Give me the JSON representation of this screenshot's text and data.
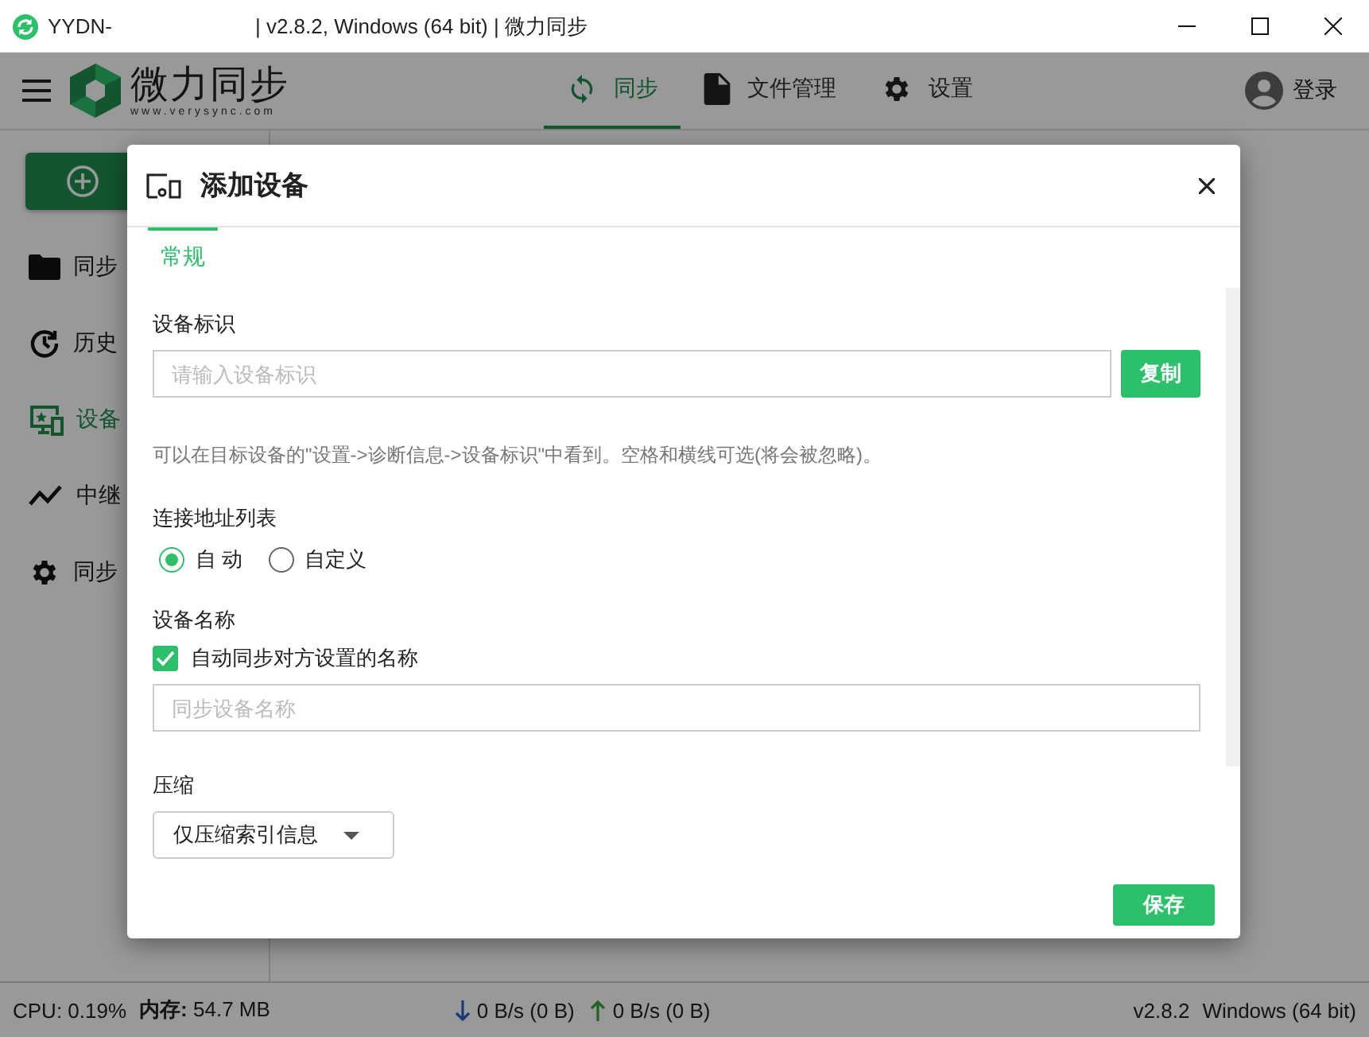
{
  "window": {
    "title_name": "YYDN-",
    "title_rest": "| v2.8.2, Windows (64 bit) | 微力同步"
  },
  "header": {
    "logo_name": "微力同步",
    "logo_url": "www.verysync.com",
    "nav": [
      {
        "label": "同步",
        "selected": true
      },
      {
        "label": "文件管理",
        "selected": false
      },
      {
        "label": "设置",
        "selected": false
      }
    ],
    "login": "登录"
  },
  "sidebar": {
    "items": [
      {
        "label": "同步",
        "selected": false
      },
      {
        "label": "历史",
        "selected": false
      },
      {
        "label": "设备",
        "selected": true
      },
      {
        "label": "中继",
        "selected": false
      },
      {
        "label": "同步",
        "selected": false
      }
    ]
  },
  "dialog": {
    "title": "添加设备",
    "tabs": [
      {
        "label": "常规",
        "selected": true
      }
    ],
    "device_id": {
      "label": "设备标识",
      "placeholder": "请输入设备标识",
      "button": "复制"
    },
    "hint": "可以在目标设备的\"设置->诊断信息->设备标识\"中看到。空格和横线可选(将会被忽略)。",
    "address": {
      "label": "连接地址列表",
      "options": [
        {
          "label": "自 动",
          "selected": true
        },
        {
          "label": "自定义",
          "selected": false
        }
      ]
    },
    "device_name": {
      "label": "设备名称",
      "auto_sync": {
        "label": "自动同步对方设置的名称",
        "checked": true
      },
      "placeholder": "同步设备名称"
    },
    "compression": {
      "label": "压缩",
      "value": "仅压缩索引信息"
    },
    "save": "保存"
  },
  "status_bar": {
    "cpu": "CPU: 0.19%",
    "memory": "**内存:** 54.7 MB",
    "download": "0 B/s (0 B)",
    "upload": "0 B/s (0 B)",
    "version": "v2.8.2",
    "os": "Windows (64 bit)"
  }
}
